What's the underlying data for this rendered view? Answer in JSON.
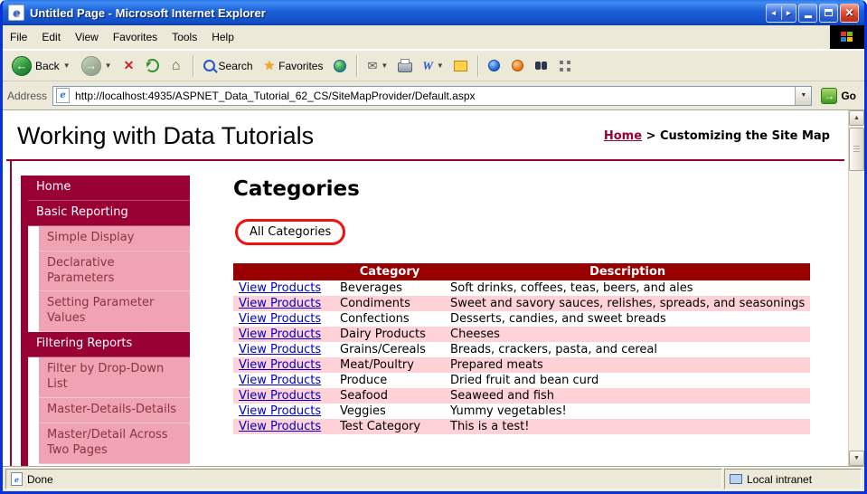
{
  "window": {
    "title": "Untitled Page - Microsoft Internet Explorer",
    "status_left": "Done",
    "status_right": "Local intranet"
  },
  "menu": {
    "items": [
      "File",
      "Edit",
      "View",
      "Favorites",
      "Tools",
      "Help"
    ]
  },
  "toolbar": {
    "back_label": "Back",
    "search_label": "Search",
    "favorites_label": "Favorites"
  },
  "address": {
    "label": "Address",
    "url": "http://localhost:4935/ASPNET_Data_Tutorial_62_CS/SiteMapProvider/Default.aspx",
    "go_label": "Go"
  },
  "page": {
    "title": "Working with Data Tutorials",
    "breadcrumb": {
      "home": "Home",
      "separator": ">",
      "current": "Customizing the Site Map"
    },
    "sidebar": {
      "items": [
        {
          "label": "Home",
          "level": 1
        },
        {
          "label": "Basic Reporting",
          "level": 1
        },
        {
          "label": "Simple Display",
          "level": 2
        },
        {
          "label": "Declarative Parameters",
          "level": 2
        },
        {
          "label": "Setting Parameter Values",
          "level": 2
        },
        {
          "label": "Filtering Reports",
          "level": 1
        },
        {
          "label": "Filter by Drop-Down List",
          "level": 2
        },
        {
          "label": "Master-Details-Details",
          "level": 2
        },
        {
          "label": "Master/Detail Across Two Pages",
          "level": 2
        }
      ]
    },
    "main": {
      "heading": "Categories",
      "filter_label": "All Categories",
      "table": {
        "headers": [
          "",
          "Category",
          "Description"
        ],
        "link_label": "View Products",
        "rows": [
          {
            "category": "Beverages",
            "description": "Soft drinks, coffees, teas, beers, and ales"
          },
          {
            "category": "Condiments",
            "description": "Sweet and savory sauces, relishes, spreads, and seasonings"
          },
          {
            "category": "Confections",
            "description": "Desserts, candies, and sweet breads"
          },
          {
            "category": "Dairy Products",
            "description": "Cheeses"
          },
          {
            "category": "Grains/Cereals",
            "description": "Breads, crackers, pasta, and cereal"
          },
          {
            "category": "Meat/Poultry",
            "description": "Prepared meats"
          },
          {
            "category": "Produce",
            "description": "Dried fruit and bean curd"
          },
          {
            "category": "Seafood",
            "description": "Seaweed and fish"
          },
          {
            "category": "Veggies",
            "description": "Yummy vegetables!"
          },
          {
            "category": "Test Category",
            "description": "This is a test!"
          }
        ]
      }
    }
  },
  "colors": {
    "maroon_accent": "#990033",
    "table_header_red": "#990000",
    "pink_row": "#ffd2d7",
    "pink_nav_item": "#f0a3b2",
    "annotation_red": "#ee1111",
    "link_blue": "#0000cc",
    "titlebar_blue": "#1b5fd8"
  }
}
